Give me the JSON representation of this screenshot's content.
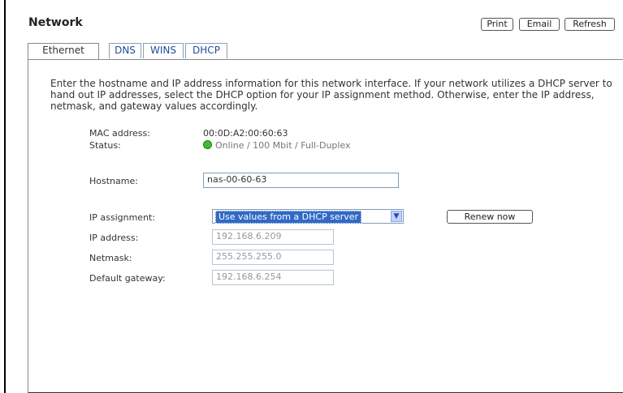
{
  "page": {
    "title": "Network"
  },
  "header_buttons": {
    "print": "Print",
    "email": "Email",
    "refresh": "Refresh"
  },
  "tabs": [
    {
      "label": "Ethernet",
      "active": true
    },
    {
      "label": "DNS",
      "active": false
    },
    {
      "label": "WINS",
      "active": false
    },
    {
      "label": "DHCP",
      "active": false
    }
  ],
  "intro": "Enter the hostname and IP address information for this network interface. If your network utilizes a DHCP server to hand out IP addresses, select the DHCP option for your IP assignment method. Otherwise, enter the IP address, netmask, and gateway values accordingly.",
  "fields": {
    "mac_label": "MAC address:",
    "mac_value": "00:0D:A2:00:60:63",
    "status_label": "Status:",
    "status_value": "Online / 100 Mbit / Full-Duplex",
    "status_color": "#3cbf2c",
    "hostname_label": "Hostname:",
    "hostname_value": "nas-00-60-63",
    "ip_assignment_label": "IP assignment:",
    "ip_assignment_value": "Use values from a DHCP server",
    "renew_label": "Renew now",
    "ip_label": "IP address:",
    "ip_value": "192.168.6.209",
    "netmask_label": "Netmask:",
    "netmask_value": "255.255.255.0",
    "gateway_label": "Default gateway:",
    "gateway_value": "192.168.6.254"
  }
}
